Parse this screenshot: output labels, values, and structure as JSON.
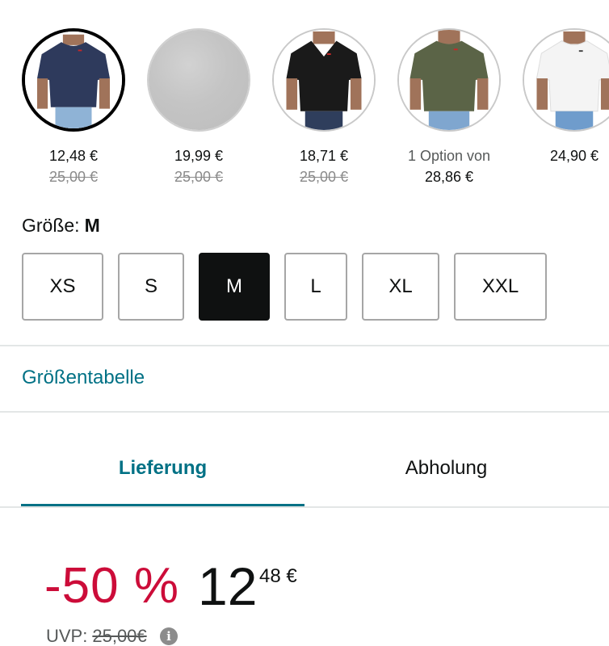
{
  "swatches": [
    {
      "name": "navy",
      "price": "12,48 €",
      "strike": "25,00 €",
      "color": "#2e3a5c",
      "selected": true
    },
    {
      "name": "gray",
      "price": "19,99 €",
      "strike": "25,00 €",
      "color": "#c4c4c4",
      "selected": false
    },
    {
      "name": "black",
      "price": "18,71 €",
      "strike": "25,00 €",
      "color": "#1a1a1a",
      "selected": false
    },
    {
      "name": "olive",
      "option": "1 Option von",
      "price": "28,86 €",
      "color": "#5b6447",
      "selected": false
    },
    {
      "name": "white",
      "price": "24,90 €",
      "color": "#f4f4f4",
      "selected": false
    }
  ],
  "size": {
    "label": "Größe:",
    "selected": "M",
    "options": [
      "XS",
      "S",
      "M",
      "L",
      "XL",
      "XXL"
    ]
  },
  "size_chart_link": "Größentabelle",
  "tabs": {
    "delivery": "Lieferung",
    "pickup": "Abholung"
  },
  "price": {
    "discount": "-50 %",
    "whole": "12",
    "fraction": "48 €",
    "uvp_label": "UVP:",
    "uvp_value": "25,00€",
    "info_glyph": "i"
  },
  "colors": {
    "accent": "#007185",
    "discount": "#cc0c39",
    "selected_size": "#0f1111"
  }
}
